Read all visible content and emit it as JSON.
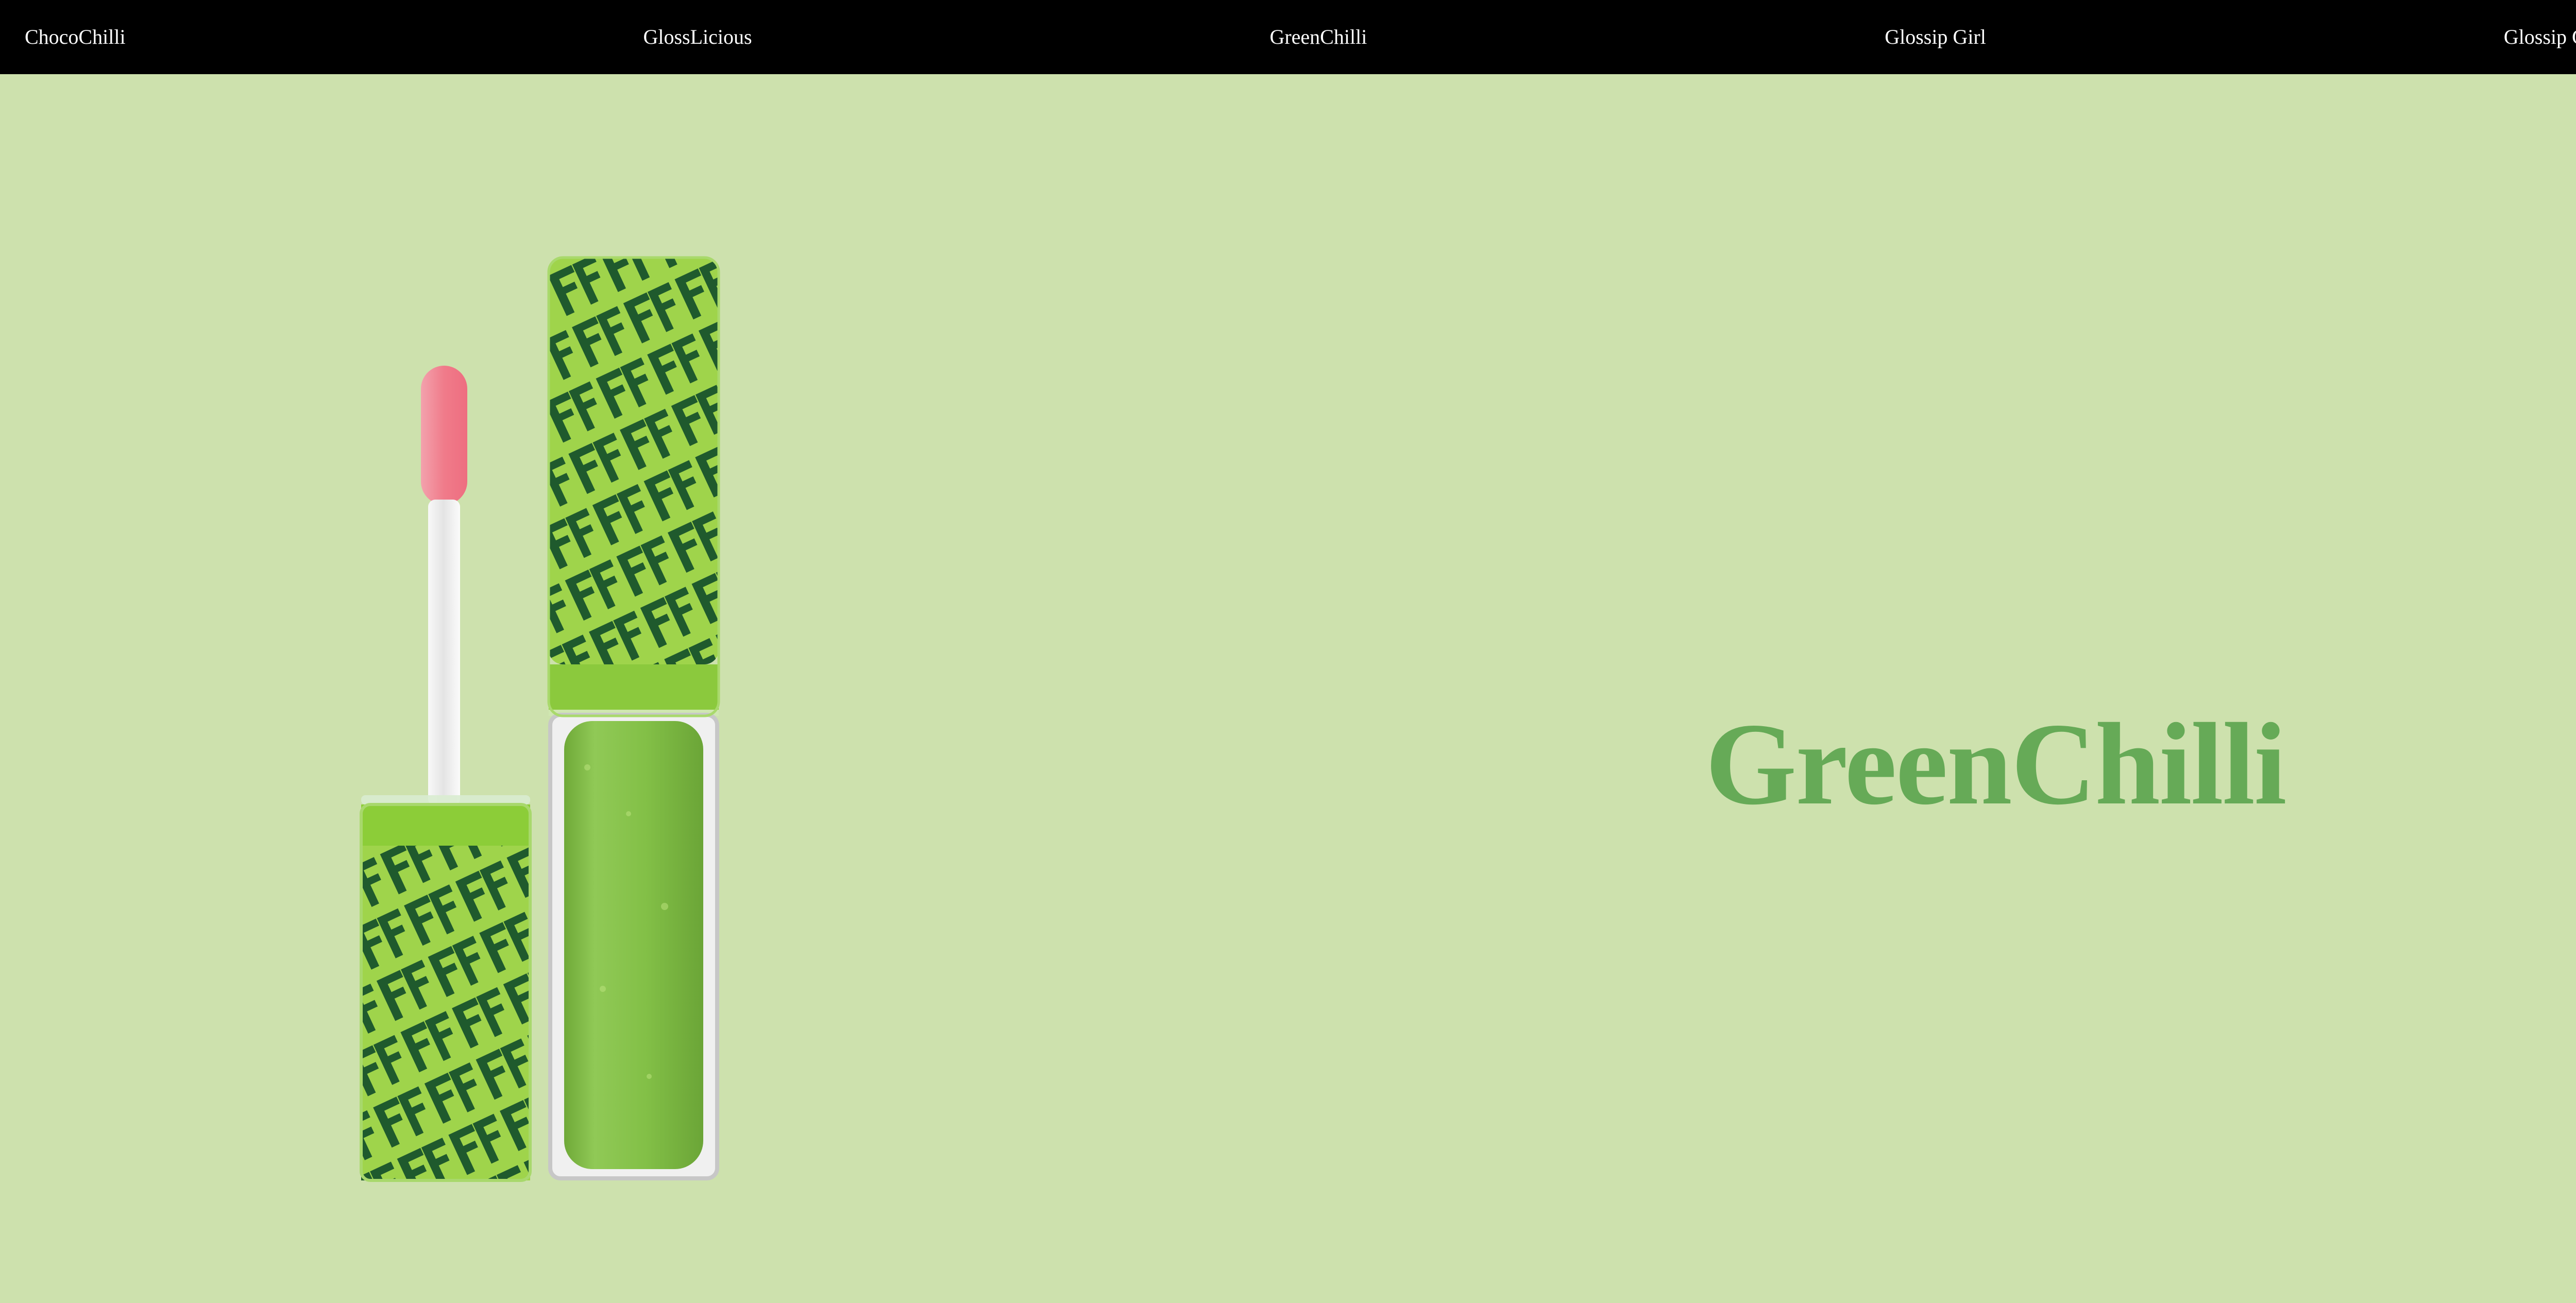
{
  "nav": {
    "items": [
      {
        "label": "ChocoChilli"
      },
      {
        "label": "GlossLicious"
      },
      {
        "label": "GreenChilli"
      },
      {
        "label": "Glossip Girl"
      },
      {
        "label": "Glossip Gold"
      }
    ]
  },
  "hero": {
    "title": "GreenChilli"
  },
  "product_image": {
    "name": "green-lip-gloss-product-image"
  },
  "colors": {
    "background": "#cde1ad",
    "nav_background": "#000000",
    "nav_text": "#ffffff",
    "title": "#66aa57",
    "gloss": "#8cc84b",
    "pattern_dark": "#1f5a2d",
    "pattern_light": "#9fd44b",
    "applicator_tip": "#f07b8a"
  }
}
